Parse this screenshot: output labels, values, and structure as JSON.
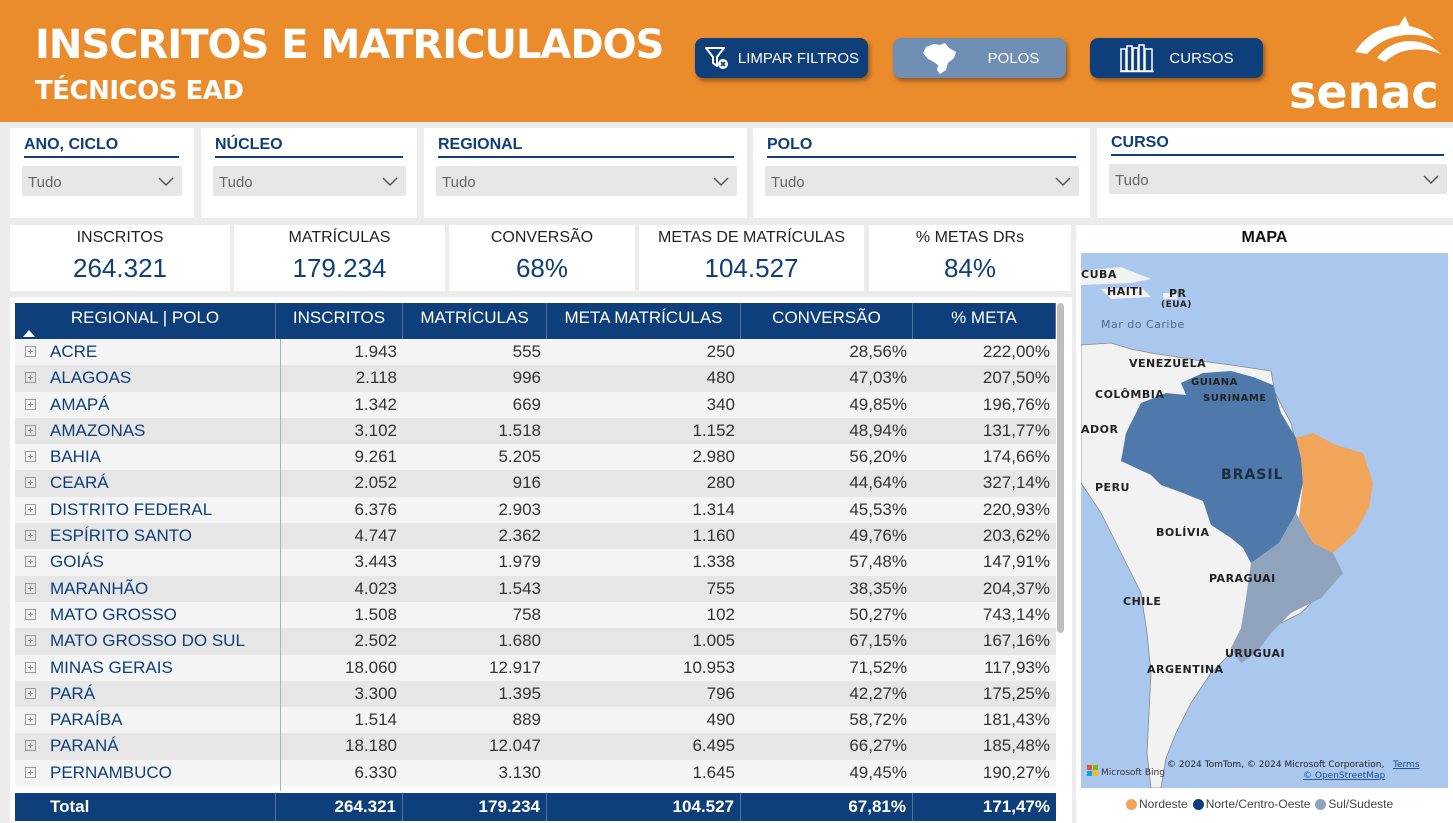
{
  "header": {
    "title": "INSCRITOS E MATRICULADOS",
    "subtitle": "TÉCNICOS EAD",
    "buttons": {
      "clear": "LIMPAR FILTROS",
      "polos": "POLOS",
      "cursos": "CURSOS"
    },
    "logo_text": "senac"
  },
  "filters": [
    {
      "label": "ANO, CICLO",
      "value": "Tudo"
    },
    {
      "label": "NÚCLEO",
      "value": "Tudo"
    },
    {
      "label": "REGIONAL",
      "value": "Tudo"
    },
    {
      "label": "POLO",
      "value": "Tudo"
    },
    {
      "label": "CURSO",
      "value": "Tudo"
    }
  ],
  "kpis": [
    {
      "label": "INSCRITOS",
      "value": "264.321"
    },
    {
      "label": "MATRÍCULAS",
      "value": "179.234"
    },
    {
      "label": "CONVERSÃO",
      "value": "68%"
    },
    {
      "label": "METAS DE MATRÍCULAS",
      "value": "104.527"
    },
    {
      "label": "% METAS DRs",
      "value": "84%"
    }
  ],
  "table": {
    "columns": [
      "REGIONAL | POLO",
      "INSCRITOS",
      "MATRÍCULAS",
      "META MATRÍCULAS",
      "CONVERSÃO",
      "% META"
    ],
    "rows": [
      [
        "ACRE",
        "1.943",
        "555",
        "250",
        "28,56%",
        "222,00%"
      ],
      [
        "ALAGOAS",
        "2.118",
        "996",
        "480",
        "47,03%",
        "207,50%"
      ],
      [
        "AMAPÁ",
        "1.342",
        "669",
        "340",
        "49,85%",
        "196,76%"
      ],
      [
        "AMAZONAS",
        "3.102",
        "1.518",
        "1.152",
        "48,94%",
        "131,77%"
      ],
      [
        "BAHIA",
        "9.261",
        "5.205",
        "2.980",
        "56,20%",
        "174,66%"
      ],
      [
        "CEARÁ",
        "2.052",
        "916",
        "280",
        "44,64%",
        "327,14%"
      ],
      [
        "DISTRITO FEDERAL",
        "6.376",
        "2.903",
        "1.314",
        "45,53%",
        "220,93%"
      ],
      [
        "ESPÍRITO SANTO",
        "4.747",
        "2.362",
        "1.160",
        "49,76%",
        "203,62%"
      ],
      [
        "GOIÁS",
        "3.443",
        "1.979",
        "1.338",
        "57,48%",
        "147,91%"
      ],
      [
        "MARANHÃO",
        "4.023",
        "1.543",
        "755",
        "38,35%",
        "204,37%"
      ],
      [
        "MATO GROSSO",
        "1.508",
        "758",
        "102",
        "50,27%",
        "743,14%"
      ],
      [
        "MATO GROSSO DO SUL",
        "2.502",
        "1.680",
        "1.005",
        "67,15%",
        "167,16%"
      ],
      [
        "MINAS GERAIS",
        "18.060",
        "12.917",
        "10.953",
        "71,52%",
        "117,93%"
      ],
      [
        "PARÁ",
        "3.300",
        "1.395",
        "796",
        "42,27%",
        "175,25%"
      ],
      [
        "PARAÍBA",
        "1.514",
        "889",
        "490",
        "58,72%",
        "181,43%"
      ],
      [
        "PARANÁ",
        "18.180",
        "12.047",
        "6.495",
        "66,27%",
        "185,48%"
      ],
      [
        "PERNAMBUCO",
        "6.330",
        "3.130",
        "1.645",
        "49,45%",
        "190,27%"
      ]
    ],
    "total": [
      "Total",
      "264.321",
      "179.234",
      "104.527",
      "67,81%",
      "171,47%"
    ]
  },
  "map": {
    "title": "MAPA",
    "labels": {
      "cuba": "CUBA",
      "haiti": "HAITI",
      "pr": "PR",
      "pr_sub": "(EUA)",
      "caribe": "Mar do Caribe",
      "venezuela": "VENEZUELA",
      "guiana": "GUIANA",
      "suriname": "SURINAME",
      "colombia": "COLÔMBIA",
      "equador": "ADOR",
      "brasil": "BRASIL",
      "peru": "PERU",
      "bolivia": "BOLÍVIA",
      "paraguai": "PARAGUAI",
      "chile": "CHILE",
      "uruguai": "URUGUAI",
      "argentina": "ARGENTINA"
    },
    "attribution": "© 2024 TomTom, © 2024 Microsoft Corporation,",
    "terms": "Terms",
    "osm": "© OpenStreetMap",
    "bing": "Microsoft Bing",
    "legend": [
      {
        "name": "Nordeste",
        "color": "#f0a55a"
      },
      {
        "name": "Norte/Centro-Oeste",
        "color": "#0e3f7b"
      },
      {
        "name": "Sul/Sudeste",
        "color": "#8fa3bd"
      }
    ]
  },
  "colors": {
    "header": "#ea8b2c",
    "navy": "#0e3f7b",
    "button_inactive": "#6f8fb5"
  }
}
